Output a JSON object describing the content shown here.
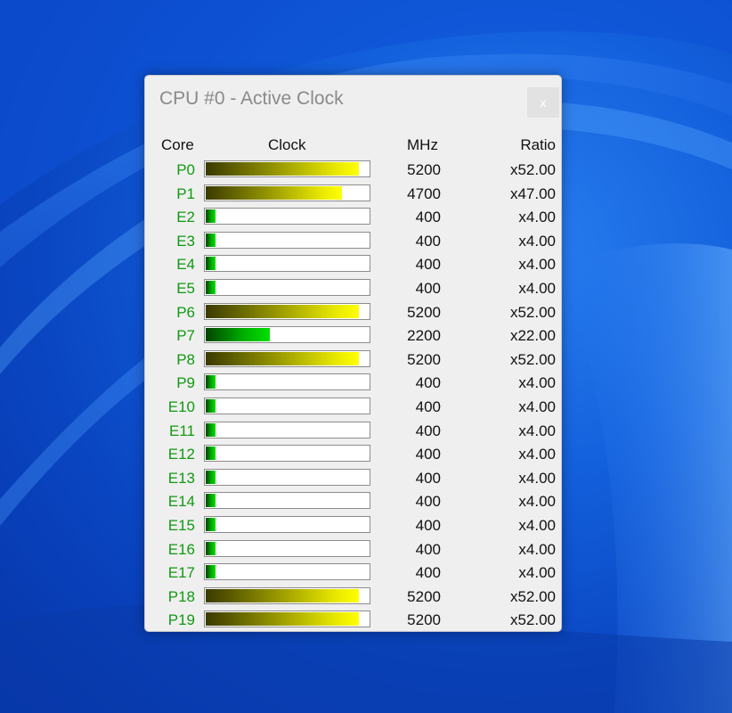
{
  "window": {
    "title": "CPU #0 - Active Clock",
    "close_label": "x"
  },
  "columns": {
    "core": "Core",
    "clock": "Clock",
    "mhz": "MHz",
    "ratio": "Ratio"
  },
  "colors": {
    "core_label": "#119911",
    "high_clock_bar": "#e8e800",
    "low_clock_bar": "#00b000"
  },
  "max_clock_mhz": 5400,
  "cores": [
    {
      "core": "P0",
      "mhz": "5200",
      "ratio": "x52.00",
      "level": 0.94,
      "bar_color": "yellow"
    },
    {
      "core": "P1",
      "mhz": "4700",
      "ratio": "x47.00",
      "level": 0.84,
      "bar_color": "yellow"
    },
    {
      "core": "E2",
      "mhz": "400",
      "ratio": "x4.00",
      "level": 0.07,
      "bar_color": "green"
    },
    {
      "core": "E3",
      "mhz": "400",
      "ratio": "x4.00",
      "level": 0.07,
      "bar_color": "green"
    },
    {
      "core": "E4",
      "mhz": "400",
      "ratio": "x4.00",
      "level": 0.07,
      "bar_color": "green"
    },
    {
      "core": "E5",
      "mhz": "400",
      "ratio": "x4.00",
      "level": 0.07,
      "bar_color": "green"
    },
    {
      "core": "P6",
      "mhz": "5200",
      "ratio": "x52.00",
      "level": 0.94,
      "bar_color": "yellow"
    },
    {
      "core": "P7",
      "mhz": "2200",
      "ratio": "x22.00",
      "level": 0.4,
      "bar_color": "green"
    },
    {
      "core": "P8",
      "mhz": "5200",
      "ratio": "x52.00",
      "level": 0.94,
      "bar_color": "yellow"
    },
    {
      "core": "P9",
      "mhz": "400",
      "ratio": "x4.00",
      "level": 0.07,
      "bar_color": "green"
    },
    {
      "core": "E10",
      "mhz": "400",
      "ratio": "x4.00",
      "level": 0.07,
      "bar_color": "green"
    },
    {
      "core": "E11",
      "mhz": "400",
      "ratio": "x4.00",
      "level": 0.07,
      "bar_color": "green"
    },
    {
      "core": "E12",
      "mhz": "400",
      "ratio": "x4.00",
      "level": 0.07,
      "bar_color": "green"
    },
    {
      "core": "E13",
      "mhz": "400",
      "ratio": "x4.00",
      "level": 0.07,
      "bar_color": "green"
    },
    {
      "core": "E14",
      "mhz": "400",
      "ratio": "x4.00",
      "level": 0.07,
      "bar_color": "green"
    },
    {
      "core": "E15",
      "mhz": "400",
      "ratio": "x4.00",
      "level": 0.07,
      "bar_color": "green"
    },
    {
      "core": "E16",
      "mhz": "400",
      "ratio": "x4.00",
      "level": 0.07,
      "bar_color": "green"
    },
    {
      "core": "E17",
      "mhz": "400",
      "ratio": "x4.00",
      "level": 0.07,
      "bar_color": "green"
    },
    {
      "core": "P18",
      "mhz": "5200",
      "ratio": "x52.00",
      "level": 0.94,
      "bar_color": "yellow"
    },
    {
      "core": "P19",
      "mhz": "5200",
      "ratio": "x52.00",
      "level": 0.94,
      "bar_color": "yellow"
    }
  ]
}
